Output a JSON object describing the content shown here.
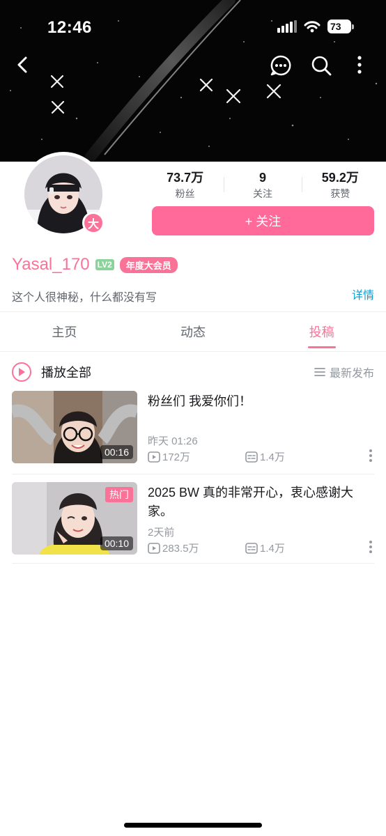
{
  "status_bar": {
    "time": "12:46",
    "battery": "73"
  },
  "profile": {
    "username": "Yasal_170",
    "level": "LV2",
    "member_badge": "年度大会员",
    "vip_badge": "大",
    "bio": "这个人很神秘，什么都没有写",
    "detail_link": "详情",
    "follow_button": "+ 关注",
    "stats": [
      {
        "value": "73.7万",
        "label": "粉丝"
      },
      {
        "value": "9",
        "label": "关注"
      },
      {
        "value": "59.2万",
        "label": "获赞"
      }
    ],
    "accent_color": "#fb7299"
  },
  "tabs": [
    {
      "label": "主页",
      "active": false
    },
    {
      "label": "动态",
      "active": false
    },
    {
      "label": "投稿",
      "active": true
    }
  ],
  "list_header": {
    "play_all": "播放全部",
    "sort": "最新发布"
  },
  "videos": [
    {
      "title": "粉丝们 我爱你们！",
      "time": "昨天 01:26",
      "views": "172万",
      "comments": "1.4万",
      "duration": "00:16",
      "badge": ""
    },
    {
      "title": "2025 BW 真的非常开心，衷心感谢大家。",
      "time": "2天前",
      "views": "283.5万",
      "comments": "1.4万",
      "duration": "00:10",
      "badge": "热门"
    }
  ]
}
